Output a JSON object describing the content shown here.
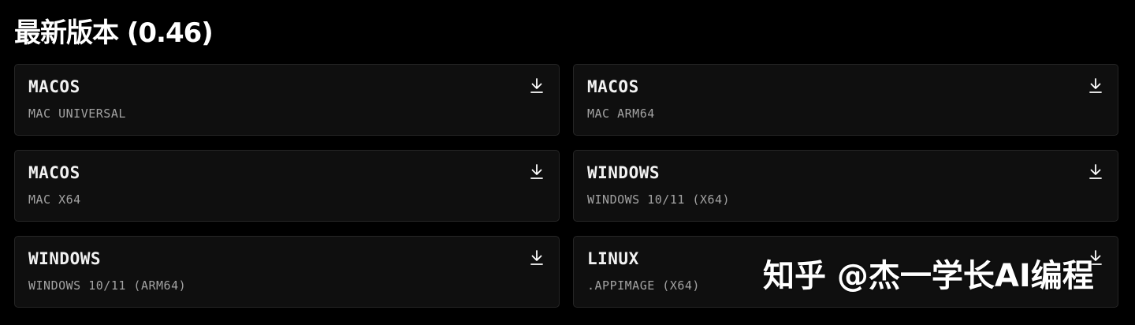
{
  "header": {
    "title": "最新版本 (0.46)"
  },
  "downloads": [
    {
      "os": "MACOS",
      "variant": "MAC UNIVERSAL",
      "icon": "download-icon"
    },
    {
      "os": "MACOS",
      "variant": "MAC ARM64",
      "icon": "download-icon"
    },
    {
      "os": "MACOS",
      "variant": "MAC X64",
      "icon": "download-icon"
    },
    {
      "os": "WINDOWS",
      "variant": "WINDOWS 10/11 (X64)",
      "icon": "download-icon"
    },
    {
      "os": "WINDOWS",
      "variant": "WINDOWS 10/11 (ARM64)",
      "icon": "download-icon"
    },
    {
      "os": "LINUX",
      "variant": ".APPIMAGE (X64)",
      "icon": "download-icon"
    }
  ],
  "watermark": {
    "text": "知乎 @杰一学长AI编程"
  },
  "colors": {
    "background": "#000000",
    "card_background": "#0f0f0f",
    "card_border": "#262626",
    "primary_text": "#f2f2f2",
    "secondary_text": "#a3a3a3"
  }
}
